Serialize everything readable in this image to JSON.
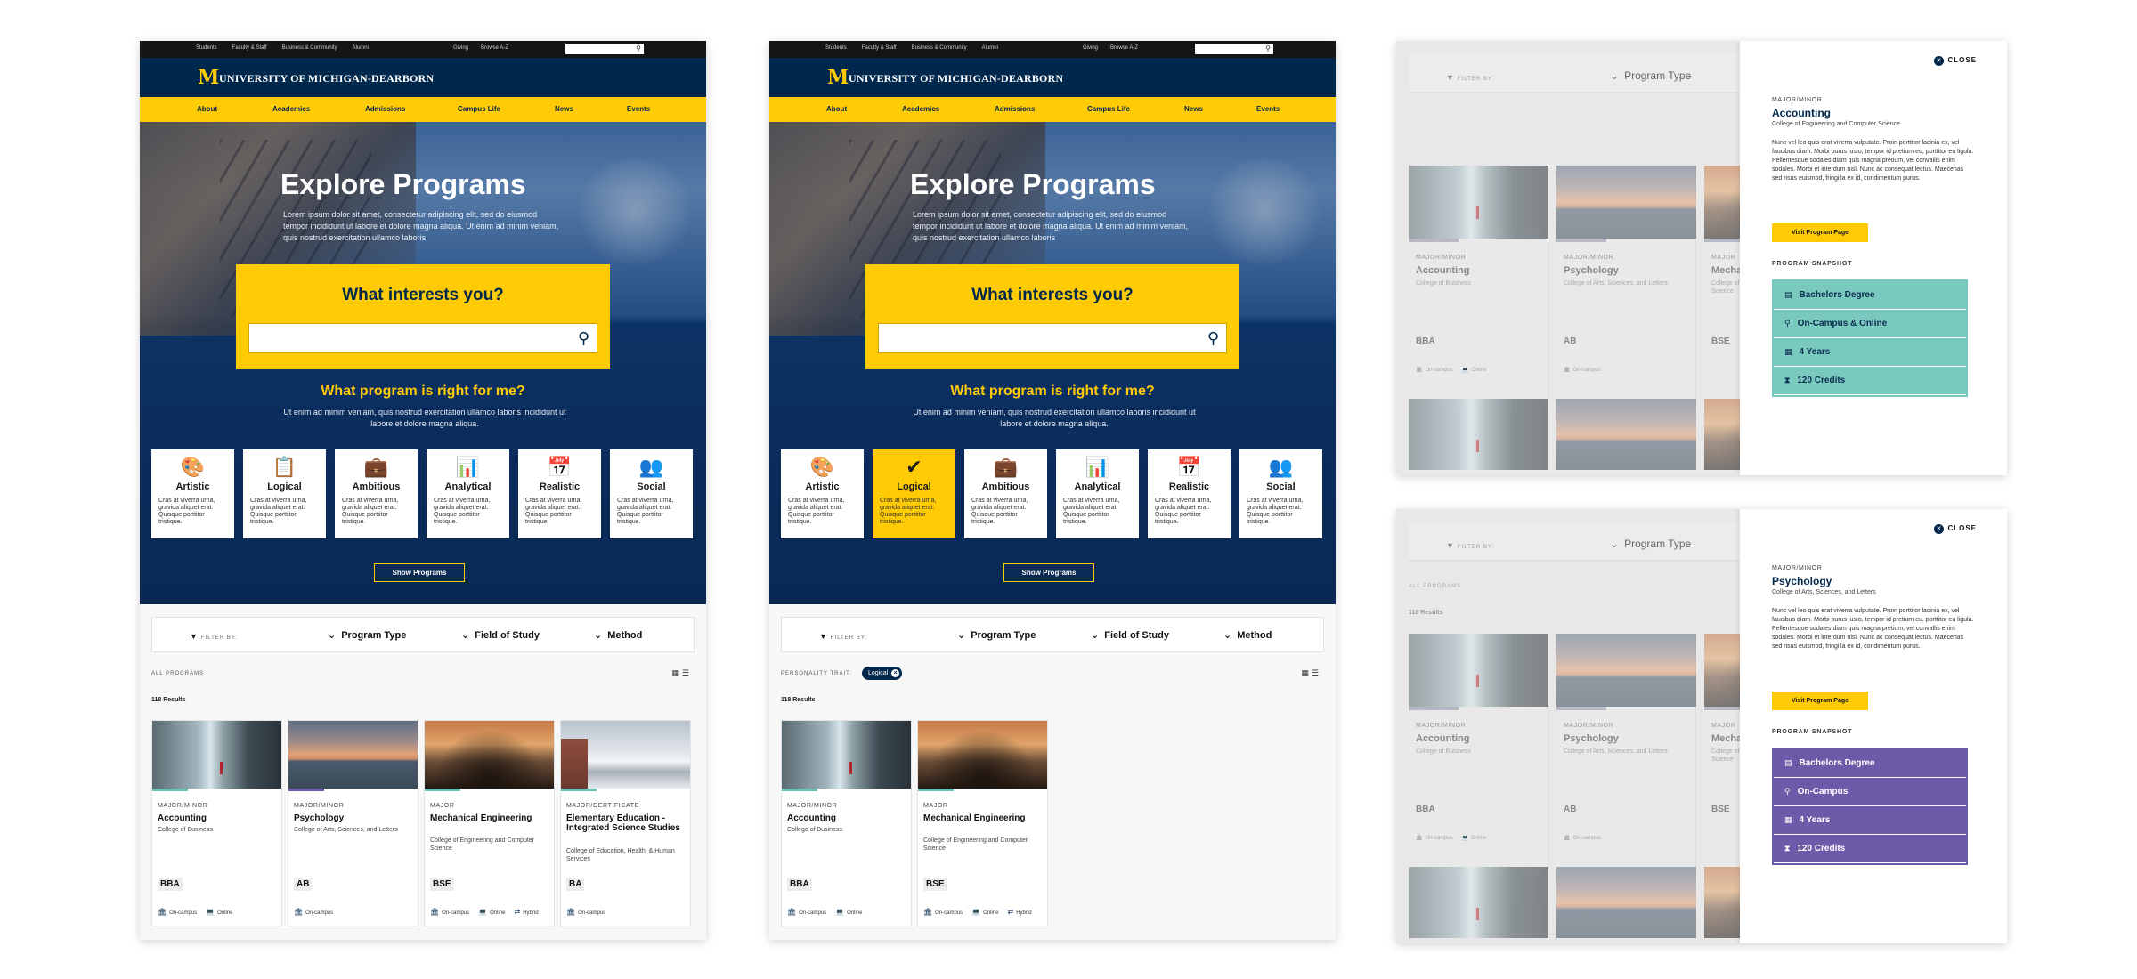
{
  "site": {
    "utility_links": [
      "Students",
      "Faculty & Staff",
      "Business & Community",
      "Alumni"
    ],
    "utility_right": [
      "Giving",
      "Browse A-Z"
    ],
    "logo_letter": "M",
    "logo_text": "UNIVERSITY OF MICHIGAN-DEARBORN",
    "nav": [
      "About",
      "Academics",
      "Admissions",
      "Campus Life",
      "News",
      "Events"
    ]
  },
  "hero": {
    "title": "Explore Programs",
    "intro": "Lorem ipsum dolor sit amet, consectetur adipiscing elit, sed do eiusmod tempor incididunt ut labore et dolore magna aliqua. Ut enim ad minim veniam, quis nostrud exercitation ullamco laboris",
    "search_heading": "What interests you?",
    "search_placeholder": "",
    "question": "What program is right for me?",
    "question_text": "Ut enim ad minim veniam, quis nostrud exercitation ullamco laboris incididunt ut labore et dolore magna aliqua.",
    "show_button": "Show Programs"
  },
  "traits": [
    {
      "name": "Artistic",
      "icon": "palette-icon",
      "glyph": "🎨",
      "desc": "Cras at viverra urna, gravida aliquet erat. Quisque porttitor tristique."
    },
    {
      "name": "Logical",
      "icon": "clipboard-check-icon",
      "glyph": "📋",
      "desc": "Cras at viverra urna, gravida aliquet erat. Quisque porttitor tristique."
    },
    {
      "name": "Ambitious",
      "icon": "briefcase-icon",
      "glyph": "💼",
      "desc": "Cras at viverra urna, gravida aliquet erat. Quisque porttitor tristique."
    },
    {
      "name": "Analytical",
      "icon": "bar-chart-icon",
      "glyph": "📊",
      "desc": "Cras at viverra urna, gravida aliquet erat. Quisque porttitor tristique."
    },
    {
      "name": "Realistic",
      "icon": "calendar-icon",
      "glyph": "📅",
      "desc": "Cras at viverra urna, gravida aliquet erat. Quisque porttitor tristique."
    },
    {
      "name": "Social",
      "icon": "people-icon",
      "glyph": "👥",
      "desc": "Cras at viverra urna, gravida aliquet erat. Quisque porttitor tristique."
    }
  ],
  "selected_trait_glyph": "✔",
  "filters": {
    "filter_by": "FILTER BY:",
    "options": [
      "Program Type",
      "Field of Study",
      "Method"
    ],
    "all_programs": "ALL PROGRAMS",
    "results": "118 Results",
    "personality_label": "PERSONALITY TRAIT:",
    "chip": "Logical"
  },
  "programs": [
    {
      "type": "MAJOR/MINOR",
      "title": "Accounting",
      "college": "College of Business",
      "degree": "BBA",
      "modes": [
        "On-campus",
        "Online"
      ],
      "image": "waterfall",
      "accent": "#6fc1b7"
    },
    {
      "type": "MAJOR/MINOR",
      "title": "Psychology",
      "college": "College of Arts, Sciences, and Letters",
      "degree": "AB",
      "modes": [
        "On-campus"
      ],
      "image": "sunset",
      "accent": "#6b5ba8"
    },
    {
      "type": "MAJOR",
      "title": "Mechanical Engineering",
      "college": "College of Engineering and Computer Science",
      "degree": "BSE",
      "modes": [
        "On-campus",
        "Online",
        "Hybrid"
      ],
      "image": "trees",
      "accent": "#6fc1b7"
    },
    {
      "type": "MAJOR/CERTIFICATE",
      "title": "Elementary Education - Integrated Science Studies",
      "college": "College of Education, Health, & Human Services",
      "degree": "BA",
      "modes": [
        "On-campus"
      ],
      "image": "snow",
      "accent": "#6fc1b7"
    }
  ],
  "drawer_accounting": {
    "close": "CLOSE",
    "type": "MAJOR/MINOR",
    "title": "Accounting",
    "college": "College of Engineering and Computer Science",
    "body": "Nunc vel leo quis erat viverra vulputate. Proin porttitor lacinia ex, vel faucibus diam. Morbi purus justo, tempor id pretium eu, porttitor eu ligula. Pellentesque sodales diam quis magna pretium, vel convallis enim sodales. Morbi et interdum nisl. Nunc ac consequat lectus. Maecenas sed risus euismod, fringilla ex id, condimentum purus.",
    "visit": "Visit Program Page",
    "snapshot": "PROGRAM SNAPSHOT",
    "rows": [
      "Bachelors Degree",
      "On-Campus & Online",
      "4 Years",
      "120 Credits"
    ],
    "color": "#79c9bf"
  },
  "drawer_psychology": {
    "close": "CLOSE",
    "type": "MAJOR/MINOR",
    "title": "Psychology",
    "college": "College of Arts, Sciences, and Letters",
    "body": "Nunc vel leo quis erat viverra vulputate. Proin porttitor lacinia ex, vel faucibus diam. Morbi purus justo, tempor id pretium eu, porttitor eu ligula. Pellentesque sodales diam quis magna pretium, vel convallis enim sodales. Morbi et interdum nisl. Nunc ac consequat lectus. Maecenas sed risus euismod, fringilla ex id, condimentum purus.",
    "visit": "Visit Program Page",
    "snapshot": "PROGRAM SNAPSHOT",
    "rows": [
      "Bachelors Degree",
      "On-Campus",
      "4 Years",
      "120 Credits"
    ],
    "color": "#6b5ba8"
  },
  "colors": {
    "navy": "#00274c",
    "maize": "#ffcb05"
  }
}
